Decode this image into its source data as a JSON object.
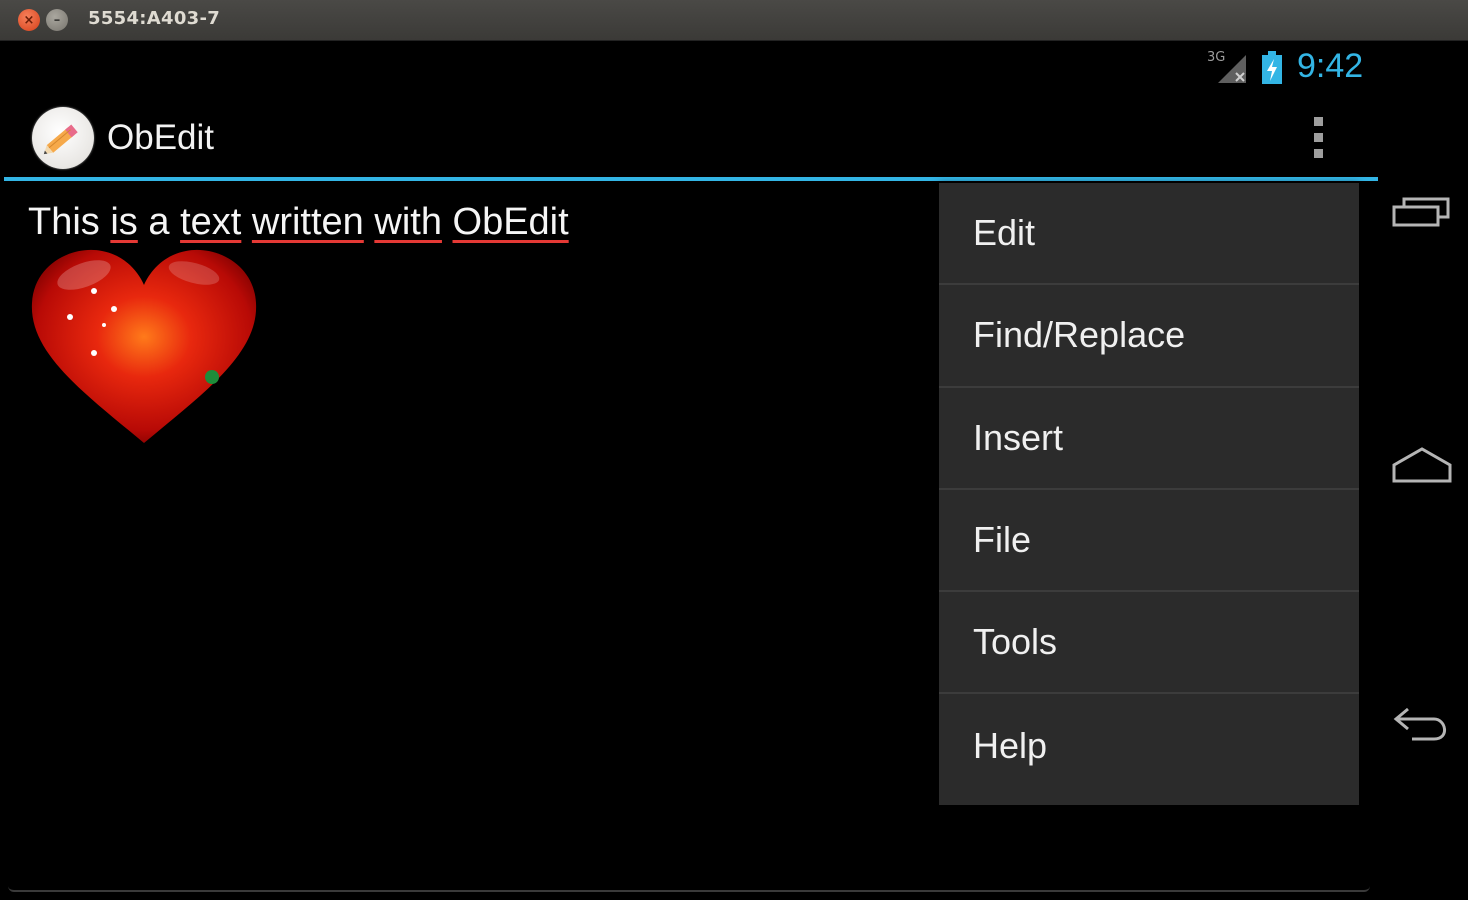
{
  "window": {
    "title": "5554:A403-7"
  },
  "status_bar": {
    "network": "3G",
    "time": "9:42",
    "clock_color": "#33b5e5",
    "icons": [
      "signal-icon",
      "battery-charging-icon"
    ]
  },
  "action_bar": {
    "app_name": "ObEdit",
    "app_icon": "pencil-icon",
    "accent_color": "#33b5e5",
    "overflow_icon": "overflow-menu-icon"
  },
  "document": {
    "words": [
      "This",
      "is",
      "a",
      "text",
      "written",
      "with",
      "ObEdit"
    ],
    "image": "heart-image"
  },
  "menu": {
    "items": [
      {
        "label": "Edit"
      },
      {
        "label": "Find/Replace"
      },
      {
        "label": "Insert"
      },
      {
        "label": "File"
      },
      {
        "label": "Tools"
      },
      {
        "label": "Help"
      }
    ]
  },
  "nav_buttons": [
    "recent-apps-icon",
    "home-icon",
    "back-icon"
  ]
}
